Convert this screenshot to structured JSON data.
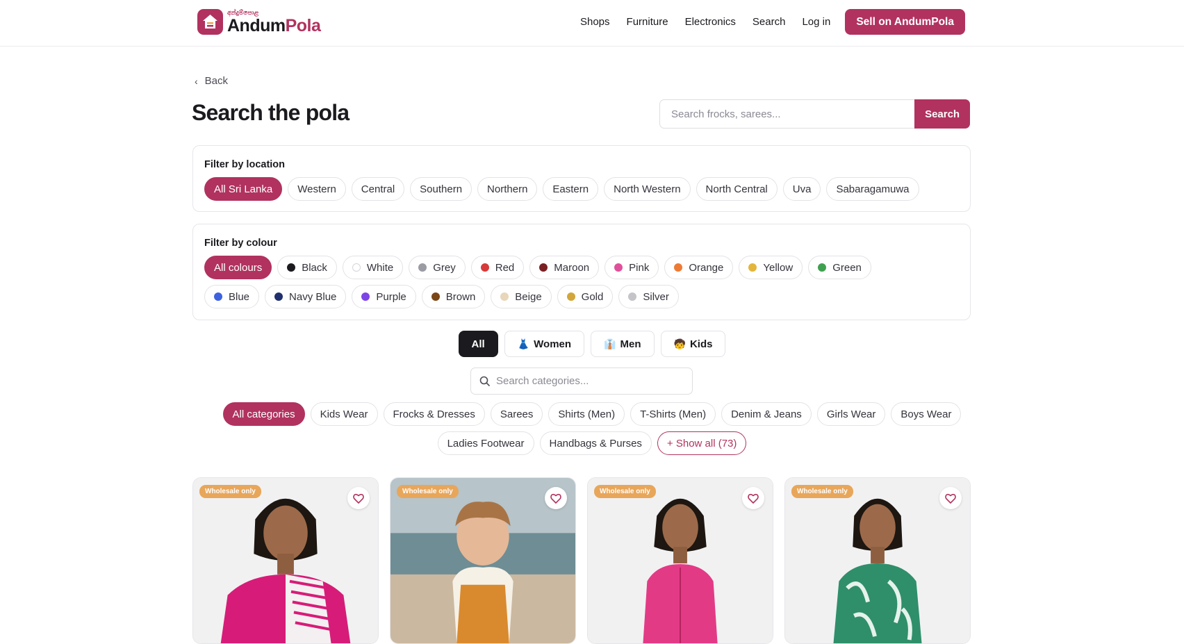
{
  "header": {
    "logo_tag": "අන්දුම්පොළ",
    "logo_word_a": "Andum",
    "logo_word_b": "Pola",
    "nav": [
      "Shops",
      "Furniture",
      "Electronics",
      "Search",
      "Log in"
    ],
    "sell_label": "Sell on AndumPola"
  },
  "back_label": "Back",
  "page_title": "Search the pola",
  "search": {
    "placeholder": "Search frocks, sarees...",
    "button": "Search"
  },
  "location_filter": {
    "title": "Filter by location",
    "options": [
      "All Sri Lanka",
      "Western",
      "Central",
      "Southern",
      "Northern",
      "Eastern",
      "North Western",
      "North Central",
      "Uva",
      "Sabaragamuwa"
    ],
    "selected": "All Sri Lanka"
  },
  "colour_filter": {
    "title": "Filter by colour",
    "all_label": "All colours",
    "colours": [
      {
        "label": "Black",
        "color": "#1a1a1f"
      },
      {
        "label": "White",
        "color": "#ffffff"
      },
      {
        "label": "Grey",
        "color": "#9b9ba3"
      },
      {
        "label": "Red",
        "color": "#d63a3a"
      },
      {
        "label": "Maroon",
        "color": "#7a1f22"
      },
      {
        "label": "Pink",
        "color": "#e0509a"
      },
      {
        "label": "Orange",
        "color": "#ec7b35"
      },
      {
        "label": "Yellow",
        "color": "#e3b53c"
      },
      {
        "label": "Green",
        "color": "#3fa150"
      },
      {
        "label": "Blue",
        "color": "#3d62e0"
      },
      {
        "label": "Navy Blue",
        "color": "#20306e"
      },
      {
        "label": "Purple",
        "color": "#7d45e6"
      },
      {
        "label": "Brown",
        "color": "#7a4517"
      },
      {
        "label": "Beige",
        "color": "#e8d6b9"
      },
      {
        "label": "Gold",
        "color": "#d2a63a"
      },
      {
        "label": "Silver",
        "color": "#c4c4c9"
      }
    ]
  },
  "gender_tabs": [
    {
      "label": "All",
      "icon": ""
    },
    {
      "label": "Women",
      "icon": "dress-icon"
    },
    {
      "label": "Men",
      "icon": "suit-icon"
    },
    {
      "label": "Kids",
      "icon": "child-icon"
    }
  ],
  "category_search": {
    "placeholder": "Search categories..."
  },
  "categories": [
    "All categories",
    "Kids Wear",
    "Frocks & Dresses",
    "Sarees",
    "Shirts (Men)",
    "T-Shirts (Men)",
    "Denim & Jeans",
    "Girls Wear",
    "Boys Wear",
    "Ladies Footwear",
    "Handbags & Purses"
  ],
  "show_all_label": "+ Show all (73)",
  "products": [
    {
      "badge": "Wholesale only"
    },
    {
      "badge": "Wholesale only"
    },
    {
      "badge": "Wholesale only"
    },
    {
      "badge": "Wholesale only"
    }
  ],
  "colors": {
    "brand": "#b1325f",
    "badge": "#e8a65a",
    "text": "#1a1a1f"
  }
}
